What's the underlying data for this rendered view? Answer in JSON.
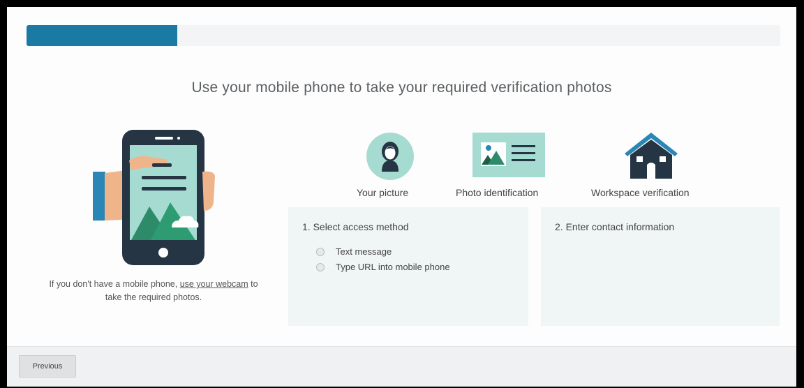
{
  "progress": {
    "percent": 20
  },
  "headline": "Use your mobile phone to take your required verification photos",
  "requirements": [
    {
      "label": "Your picture",
      "icon": "person-avatar-icon"
    },
    {
      "label": "Photo identification",
      "icon": "id-card-icon"
    },
    {
      "label": "Workspace verification",
      "icon": "house-icon"
    }
  ],
  "sidebar": {
    "illustration": "hand-holding-phone-illustration",
    "note_prefix": "If you don't have a mobile phone, ",
    "note_link": "use your webcam",
    "note_suffix": " to take the required photos."
  },
  "step1": {
    "title": "1. Select access method",
    "options": [
      {
        "label": "Text message",
        "selected": false
      },
      {
        "label": "Type URL into mobile phone",
        "selected": false
      }
    ]
  },
  "step2": {
    "title": "2. Enter contact information"
  },
  "footer": {
    "previous_label": "Previous"
  },
  "colors": {
    "accent": "#1a7aa3",
    "dark_navy": "#1f3246",
    "panel_bg": "#f0f5f5",
    "green": "#2e8b6a"
  }
}
